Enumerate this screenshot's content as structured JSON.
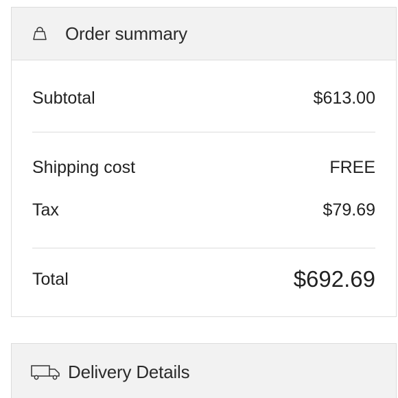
{
  "order_summary": {
    "title": "Order summary",
    "icon": "shopping-bag-icon",
    "rows": {
      "subtotal": {
        "label": "Subtotal",
        "value": "$613.00"
      },
      "shipping": {
        "label": "Shipping cost",
        "value": "FREE"
      },
      "tax": {
        "label": "Tax",
        "value": "$79.69"
      },
      "total": {
        "label": "Total",
        "value": "$692.69"
      }
    }
  },
  "delivery_details": {
    "title": "Delivery Details",
    "icon": "truck-icon"
  },
  "colors": {
    "header_background": "#f2f2f2",
    "border": "#dcdcdc",
    "text": "#222222"
  }
}
